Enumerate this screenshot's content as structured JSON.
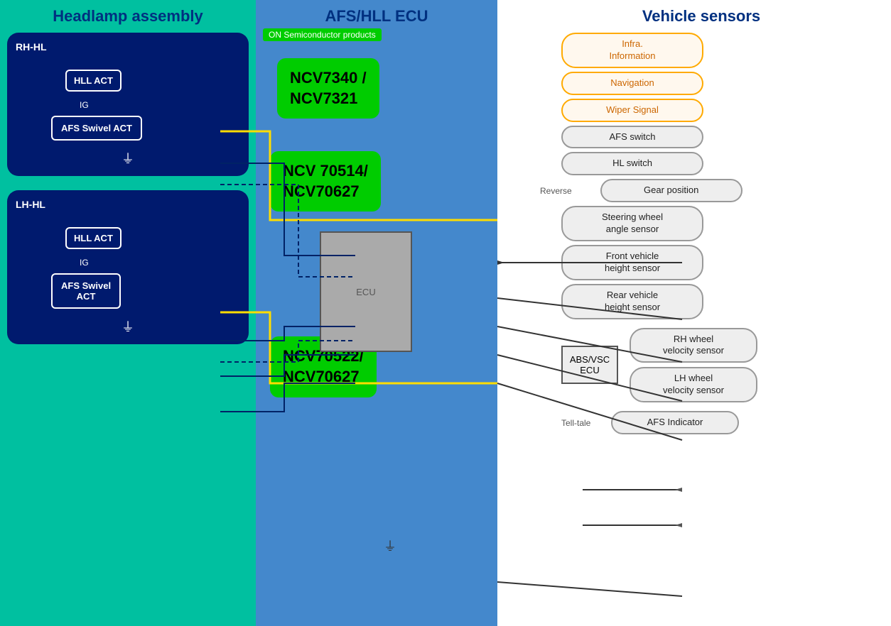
{
  "headlamp": {
    "title": "Headlamp assembly",
    "rh_label": "RH-HL",
    "lh_label": "LH-HL",
    "hll_act": "HLL ACT",
    "ig": "IG",
    "afs_swivel_act": "AFS Swivel\nACT",
    "ground": "⏚"
  },
  "ecu": {
    "title": "AFS/HLL ECU",
    "on_semi": "ON Semiconductor products",
    "chip1": "NCV7340 /\nNCV7321",
    "chip2": "NCV 70514/\nNCV70627",
    "chip3": "NCV70522/\nNCV70627",
    "reverse_label": "Reverse",
    "tell_tale_label": "Tell-tale"
  },
  "sensors": {
    "title": "Vehicle sensors",
    "items": [
      {
        "label": "Infra.\nInformation",
        "type": "orange"
      },
      {
        "label": "Navigation",
        "type": "orange"
      },
      {
        "label": "Wiper Signal",
        "type": "orange"
      },
      {
        "label": "AFS switch",
        "type": "normal"
      },
      {
        "label": "HL switch",
        "type": "normal"
      },
      {
        "label": "Gear position",
        "type": "normal"
      },
      {
        "label": "Steering wheel\nangle sensor",
        "type": "normal"
      },
      {
        "label": "Front vehicle\nheight sensor",
        "type": "normal"
      },
      {
        "label": "Rear vehicle\nheight sensor",
        "type": "normal"
      },
      {
        "label": "RH wheel\nvelocity sensor",
        "type": "normal"
      },
      {
        "label": "LH wheel\nvelocity sensor",
        "type": "normal"
      },
      {
        "label": "AFS Indicator",
        "type": "normal"
      }
    ],
    "abs_ecu": "ABS/VSC\nECU"
  }
}
